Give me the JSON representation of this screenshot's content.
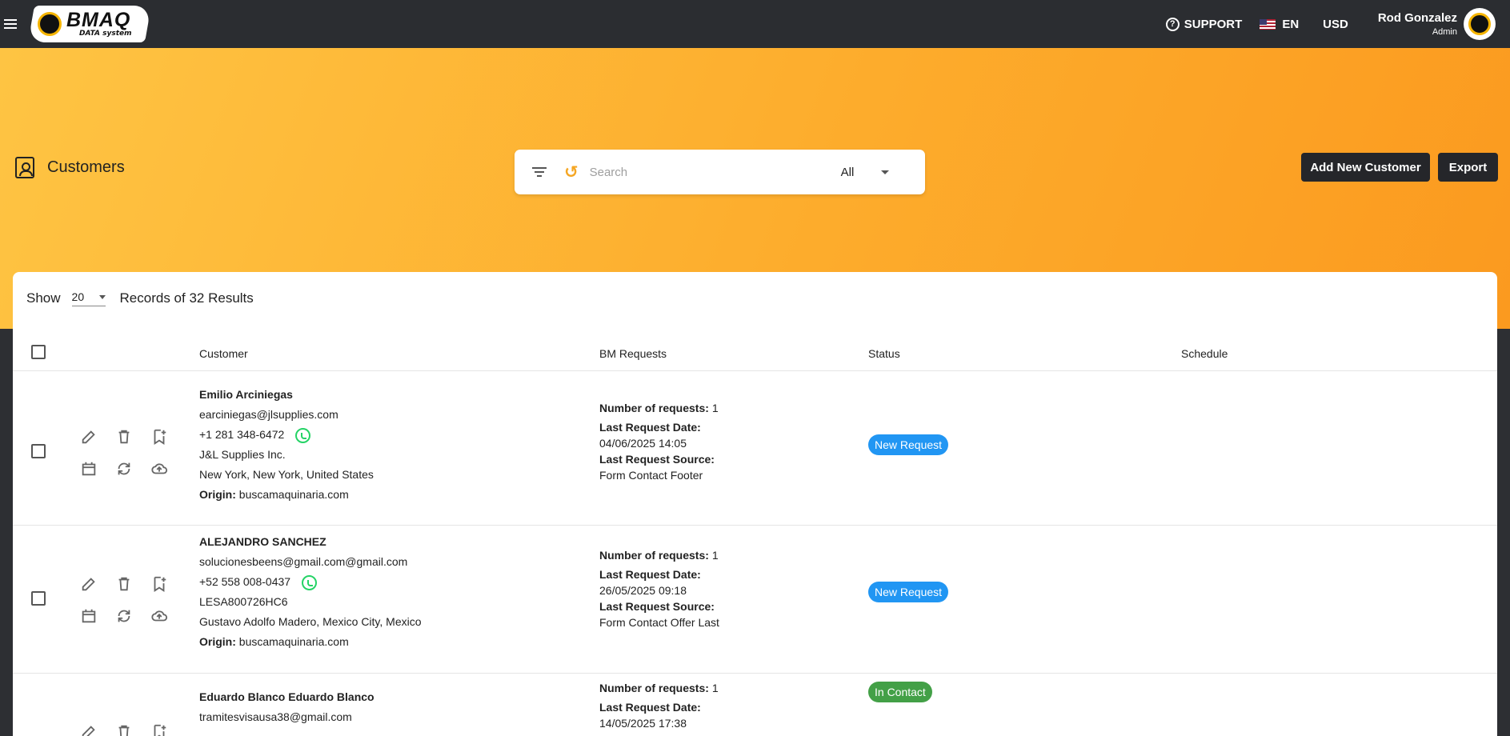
{
  "header": {
    "logo_text": "BMAQ",
    "logo_sub": "DATA system",
    "support": "SUPPORT",
    "language": "EN",
    "currency": "USD",
    "user_name": "Rod Gonzalez",
    "user_role": "Admin"
  },
  "page": {
    "title": "Customers",
    "search_placeholder": "Search",
    "filter_value": "All",
    "add_button": "Add New Customer",
    "export_button": "Export"
  },
  "table": {
    "show_label": "Show",
    "page_size": "20",
    "records_text": "Records of 32 Results",
    "columns": [
      "Customer",
      "BM Requests",
      "Status",
      "Schedule"
    ]
  },
  "labels": {
    "origin": "Origin:",
    "num_requests": "Number of requests:",
    "last_date": "Last Request Date:",
    "last_source": "Last Request Source:"
  },
  "rows": [
    {
      "name": "Emilio Arciniegas",
      "email": "earciniegas@jlsupplies.com",
      "phone": "+1 281 348-6472",
      "company": "J&L Supplies Inc.",
      "location": "New York, New York, United States",
      "origin": "buscamaquinaria.com",
      "num_requests": "1",
      "last_date": "04/06/2025 14:05",
      "last_source": "Form Contact Footer",
      "status": "New Request",
      "status_color": "#2196f3"
    },
    {
      "name": "ALEJANDRO SANCHEZ",
      "email": "solucionesbeens@gmail.com@gmail.com",
      "phone": "+52 558 008-0437",
      "company": "LESA800726HC6",
      "location": "Gustavo Adolfo Madero, Mexico City, Mexico",
      "origin": "buscamaquinaria.com",
      "num_requests": "1",
      "last_date": "26/05/2025 09:18",
      "last_source": "Form Contact Offer Last",
      "status": "New Request",
      "status_color": "#2196f3"
    },
    {
      "name": "Eduardo Blanco Eduardo Blanco",
      "email": "tramitesvisausa38@gmail.com",
      "num_requests": "1",
      "last_date": "14/05/2025 17:38",
      "status": "In Contact",
      "status_color": "#43a047"
    }
  ]
}
